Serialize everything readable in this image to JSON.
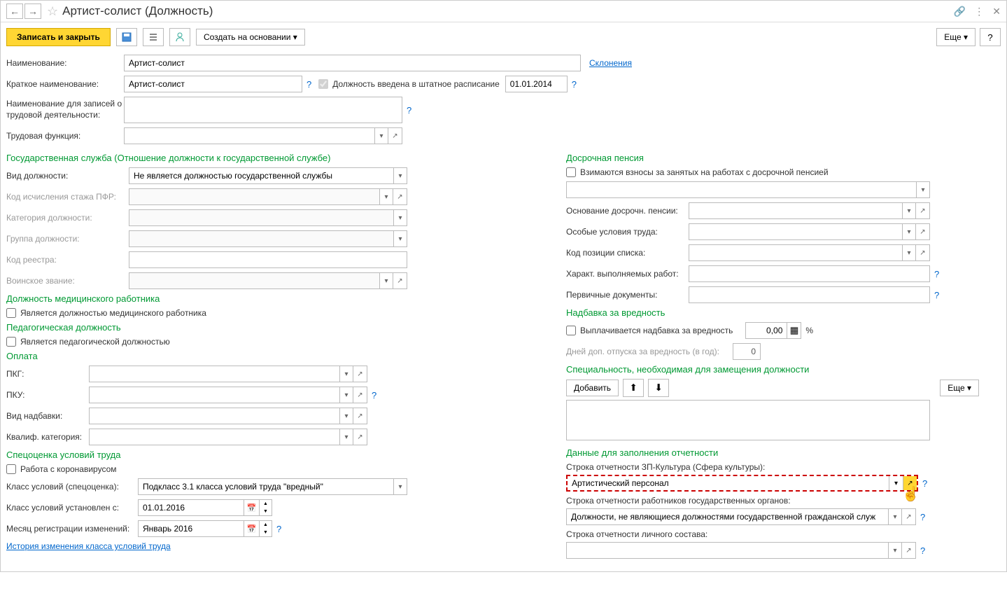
{
  "window": {
    "title": "Артист-солист (Должность)"
  },
  "toolbar": {
    "save_close": "Записать и закрыть",
    "create_based": "Создать на основании",
    "more": "Еще",
    "help": "?"
  },
  "main": {
    "name_label": "Наименование:",
    "name_value": "Артист-солист",
    "declension_link": "Склонения",
    "short_name_label": "Краткое наименование:",
    "short_name_value": "Артист-солист",
    "position_in_schedule": "Должность введена в штатное расписание",
    "position_date": "01.01.2014",
    "activity_name_label": "Наименование для записей о трудовой деятельности:",
    "labor_function_label": "Трудовая функция:"
  },
  "gov": {
    "header": "Государственная служба (Отношение должности к государственной службе)",
    "type_label": "Вид должности:",
    "type_value": "Не является должностью государственной службы",
    "pfr_code_label": "Код исчисления стажа ПФР:",
    "category_label": "Категория должности:",
    "group_label": "Группа должности:",
    "registry_label": "Код реестра:",
    "military_label": "Воинское звание:"
  },
  "medical": {
    "header": "Должность медицинского работника",
    "is_medical": "Является должностью медицинского работника"
  },
  "pedagogical": {
    "header": "Педагогическая должность",
    "is_pedagogical": "Является педагогической должностью"
  },
  "payment": {
    "header": "Оплата",
    "pkg_label": "ПКГ:",
    "pku_label": "ПКУ:",
    "bonus_type_label": "Вид надбавки:",
    "qualif_label": "Квалиф. категория:"
  },
  "assessment": {
    "header": "Спецоценка условий труда",
    "corona": "Работа с коронавирусом",
    "class_label": "Класс условий (спецоценка):",
    "class_value": "Подкласс 3.1 класса условий труда \"вредный\"",
    "established_label": "Класс условий установлен с:",
    "established_value": "01.01.2016",
    "reg_month_label": "Месяц регистрации изменений:",
    "reg_month_value": "Январь 2016",
    "history_link": "История изменения класса условий труда"
  },
  "pension": {
    "header": "Досрочная пенсия",
    "collect_fees": "Взимаются взносы за занятых на работах с досрочной пенсией",
    "basis_label": "Основание досрочн. пенсии:",
    "special_cond_label": "Особые условия труда:",
    "list_pos_label": "Код позиции списка:",
    "work_nature_label": "Характ. выполняемых работ:",
    "primary_docs_label": "Первичные документы:"
  },
  "hazard": {
    "header": "Надбавка за вредность",
    "paid": "Выплачивается надбавка за вредность",
    "amount": "0,00",
    "pct": "%",
    "vacation_label": "Дней доп. отпуска за вредность (в год):",
    "vacation_value": "0"
  },
  "speciality": {
    "header": "Специальность, необходимая для замещения должности",
    "add": "Добавить",
    "more": "Еще"
  },
  "reporting": {
    "header": "Данные для заполнения отчетности",
    "culture_label": "Строка отчетности ЗП-Культура (Сфера культуры):",
    "culture_value": "Артистический персонал",
    "gov_label": "Строка отчетности работников государственных органов:",
    "gov_value": "Должности, не являющиеся должностями государственной гражданской служ",
    "personnel_label": "Строка отчетности личного состава:"
  }
}
